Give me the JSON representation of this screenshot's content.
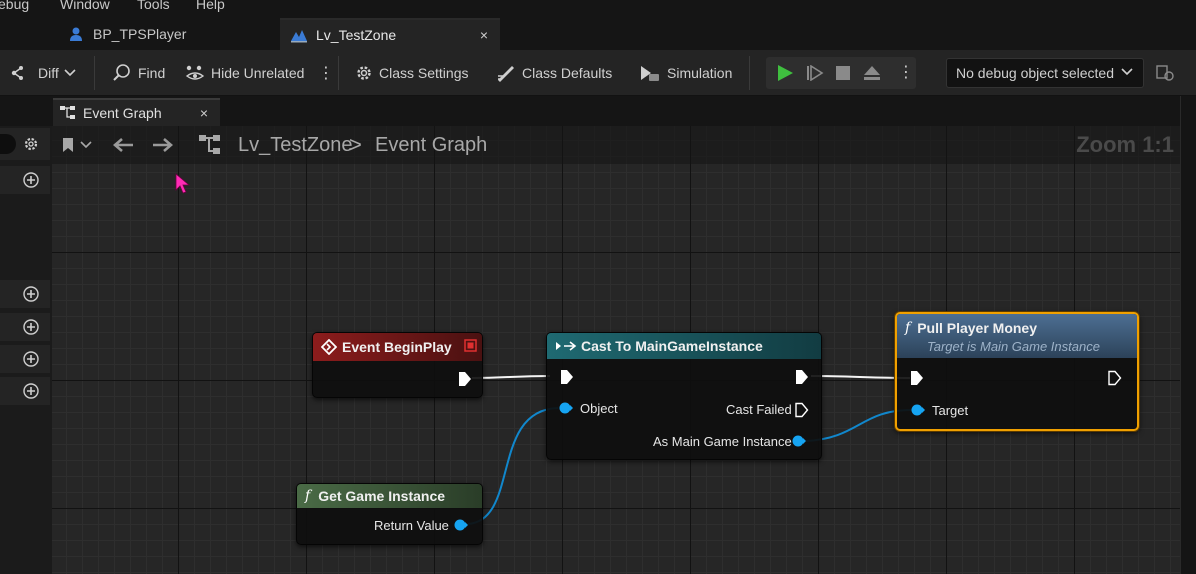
{
  "menu": {
    "items": [
      "ebug",
      "Window",
      "Tools",
      "Help"
    ]
  },
  "asset_tabs": [
    {
      "label": "BP_TPSPlayer",
      "icon": "player-blueprint-icon"
    },
    {
      "label": "Lv_TestZone",
      "icon": "level-icon",
      "close": "×"
    }
  ],
  "toolbar": {
    "diff": "Diff",
    "find": "Find",
    "hide_unrelated": "Hide Unrelated",
    "class_settings": "Class Settings",
    "class_defaults": "Class Defaults",
    "simulation": "Simulation",
    "debug_object": "No debug object selected"
  },
  "doc_tab": {
    "label": "Event Graph",
    "close": "×"
  },
  "breadcrumb": {
    "root": "Lv_TestZone",
    "separator": ">",
    "current": "Event Graph"
  },
  "zoom": "Zoom 1:1",
  "nodes": {
    "begin_play": {
      "title": "Event BeginPlay"
    },
    "cast": {
      "title": "Cast To MainGameInstance",
      "object_pin": "Object",
      "cast_failed": "Cast Failed",
      "as_output": "As Main Game Instance"
    },
    "pull_money": {
      "title": "Pull Player Money",
      "subtitle": "Target is Main Game Instance",
      "target_pin": "Target"
    },
    "get_gi": {
      "title": "Get Game Instance",
      "return_value": "Return Value"
    }
  },
  "colors": {
    "event_header": "#8c1c1c",
    "cast_header": "#1f5e66",
    "function_header": "#3e5a78",
    "pure_function_header": "#4a6b46",
    "object_pin": "#16a4f2",
    "play_button": "#3fbf3f",
    "selection": "#f0a000"
  }
}
